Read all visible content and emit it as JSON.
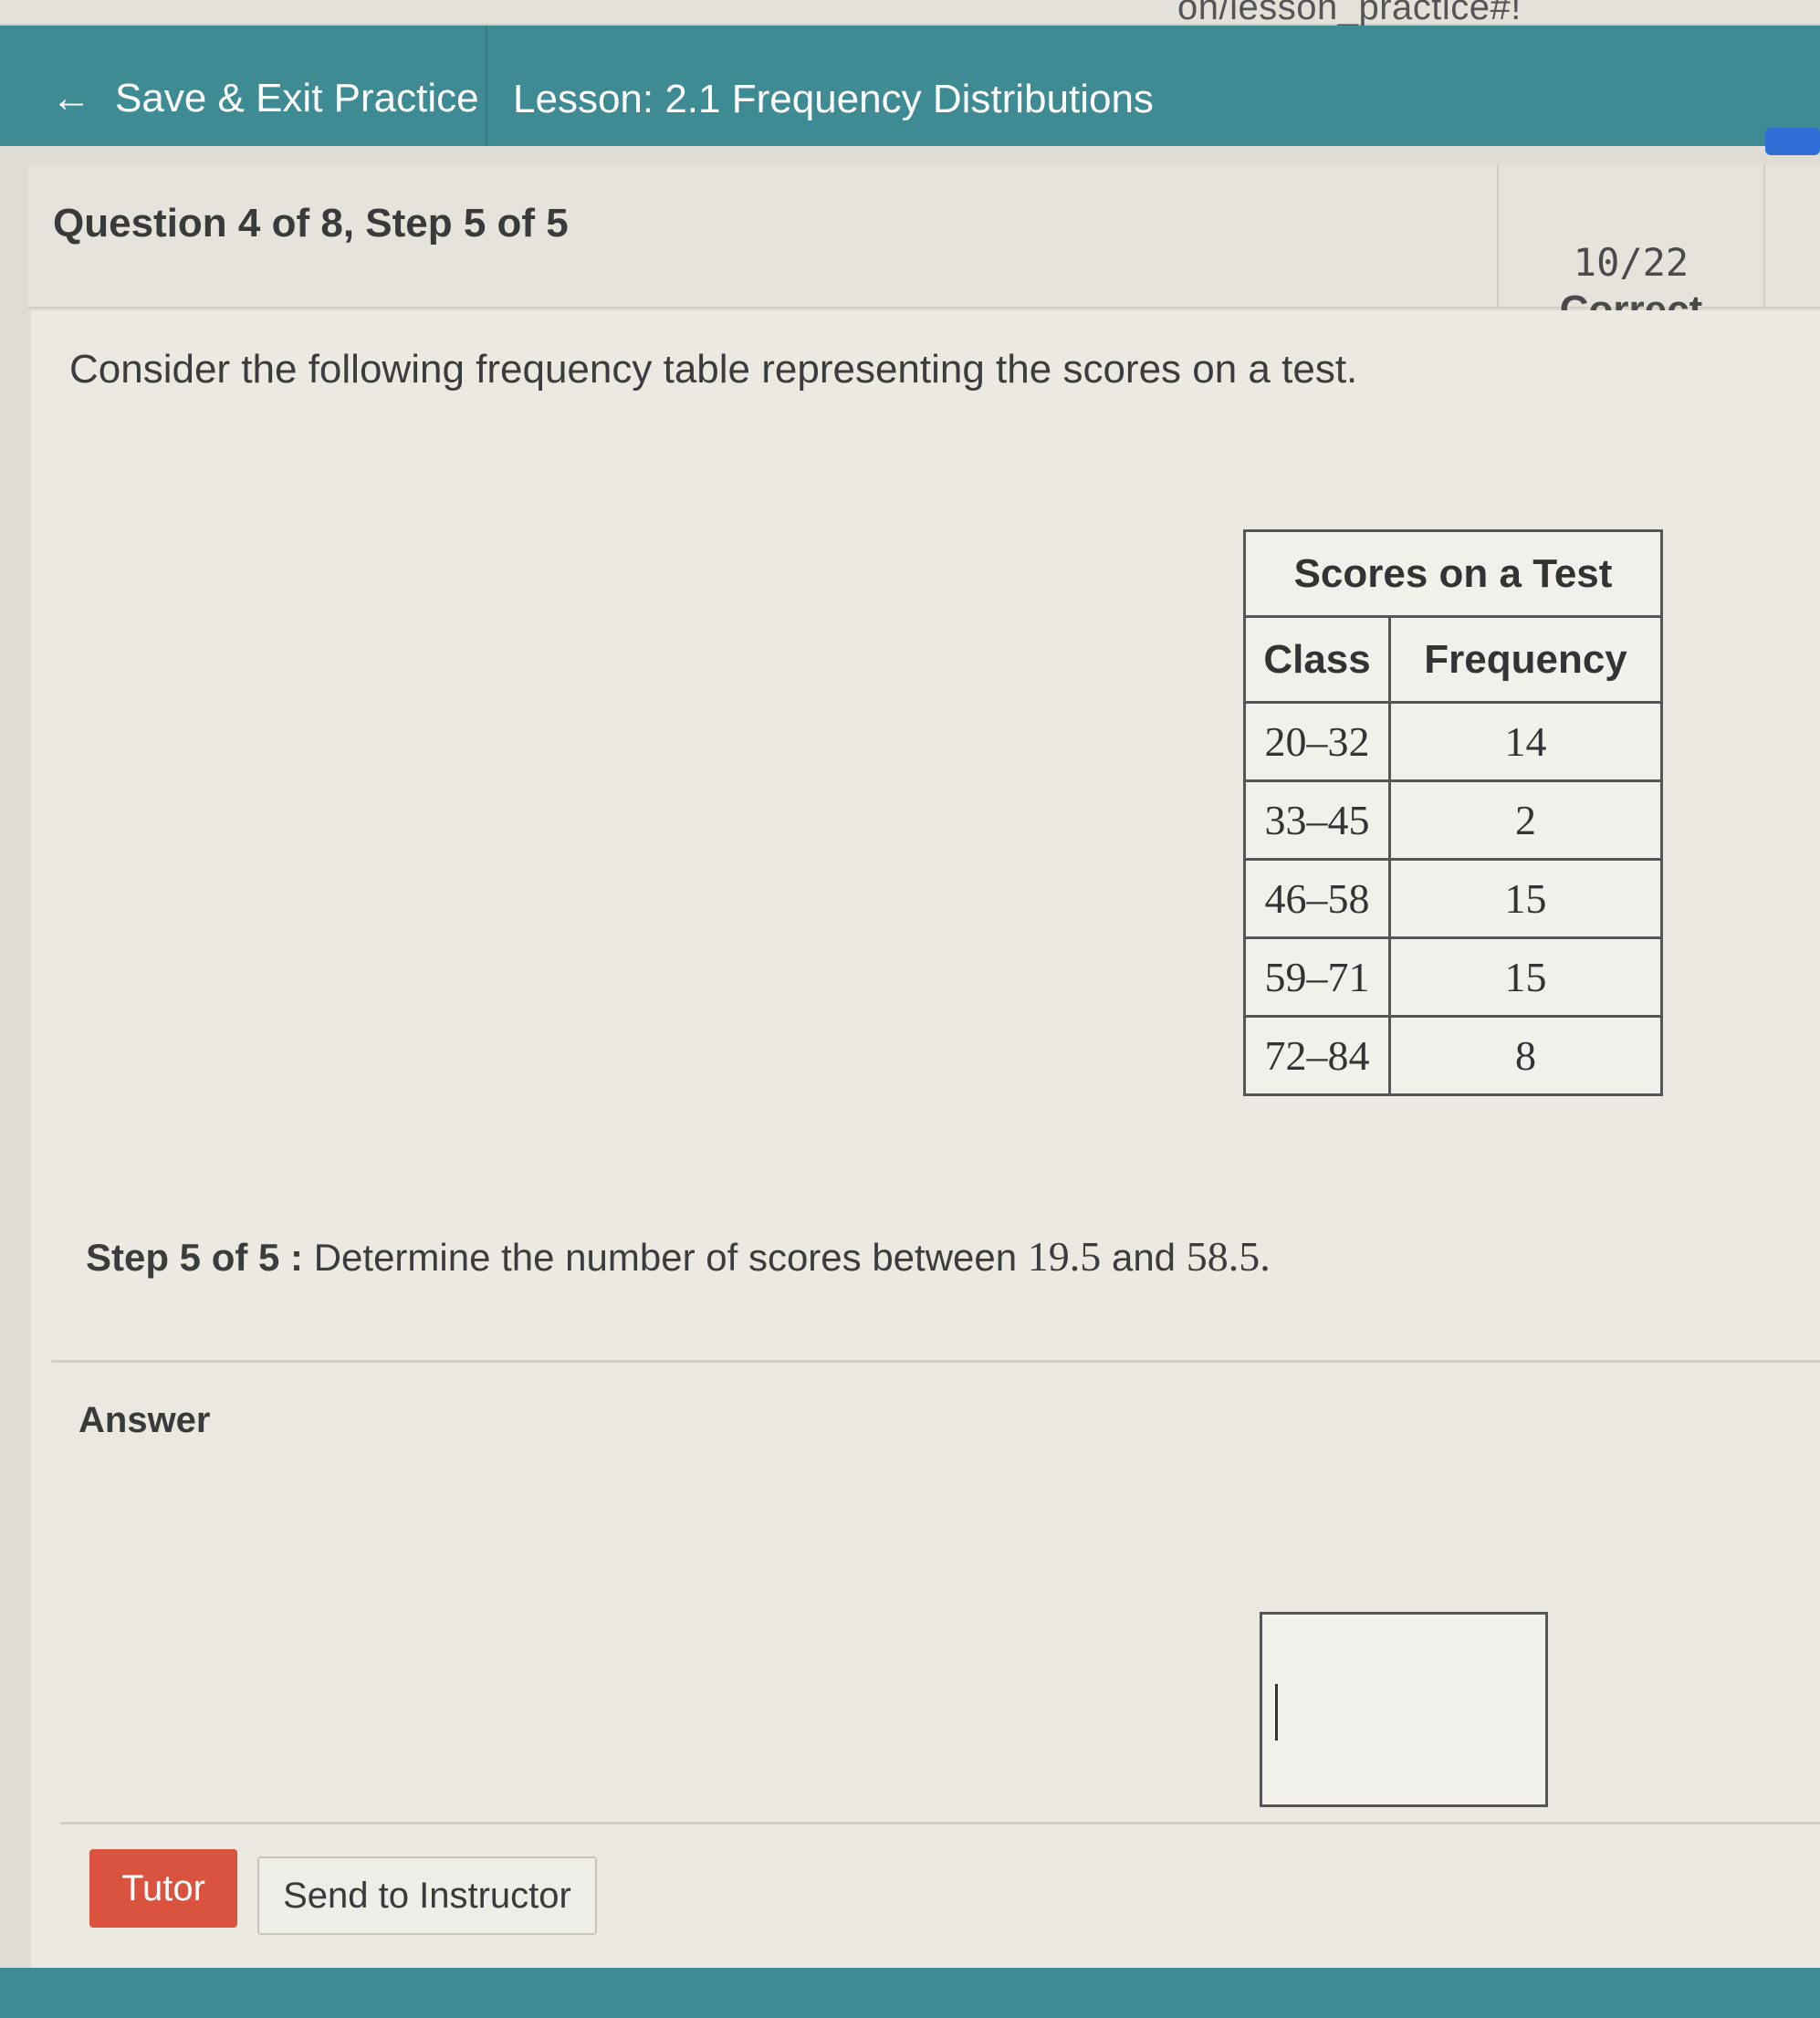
{
  "browser": {
    "url_fragment": "on/lesson_practice#!"
  },
  "header": {
    "save_exit_label": "Save & Exit Practice",
    "lesson_title": "Lesson: 2.1 Frequency Distributions"
  },
  "question": {
    "title": "Question 4 of 8,  Step 5 of 5",
    "score": "10/22",
    "score_status": "Correct",
    "prompt": "Consider the following frequency table representing the scores on a test."
  },
  "table": {
    "caption": "Scores on a Test",
    "headers": [
      "Class",
      "Frequency"
    ],
    "rows": [
      [
        "20–32",
        "14"
      ],
      [
        "33–45",
        "2"
      ],
      [
        "46–58",
        "15"
      ],
      [
        "59–71",
        "15"
      ],
      [
        "72–84",
        "8"
      ]
    ]
  },
  "step": {
    "label": "Step 5 of 5 :",
    "text": "Determine the number of scores between",
    "low": "19.5",
    "and": "and",
    "high": "58.5",
    "period": "."
  },
  "answer": {
    "label": "Answer",
    "value": ""
  },
  "buttons": {
    "tutor": "Tutor",
    "send": "Send to Instructor"
  },
  "colors": {
    "header_teal": "#3f8b94",
    "tutor_red": "#d9533f",
    "progress_blue": "#2f6fd6"
  }
}
